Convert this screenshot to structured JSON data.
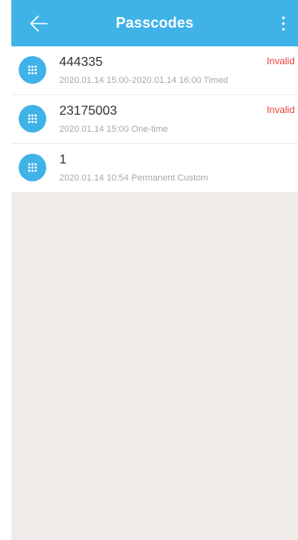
{
  "header": {
    "title": "Passcodes",
    "back_icon": "arrow-left-icon",
    "more_icon": "more-vertical-icon",
    "color": "#3fb2e8"
  },
  "passcodes": [
    {
      "code": "444335",
      "meta": "2020.01.14 15:00-2020.01.14 16:00  Timed",
      "status": "Invalid",
      "icon": "keypad-icon"
    },
    {
      "code": "23175003",
      "meta": "2020.01.14 15:00  One-time",
      "status": "Invalid",
      "icon": "keypad-icon"
    },
    {
      "code": "1",
      "meta": "2020.01.14 10:54 Permanent  Custom",
      "status": "",
      "icon": "keypad-icon"
    }
  ],
  "colors": {
    "accent": "#3fb2e8",
    "invalid": "#e8403b",
    "background": "#efebe9"
  }
}
